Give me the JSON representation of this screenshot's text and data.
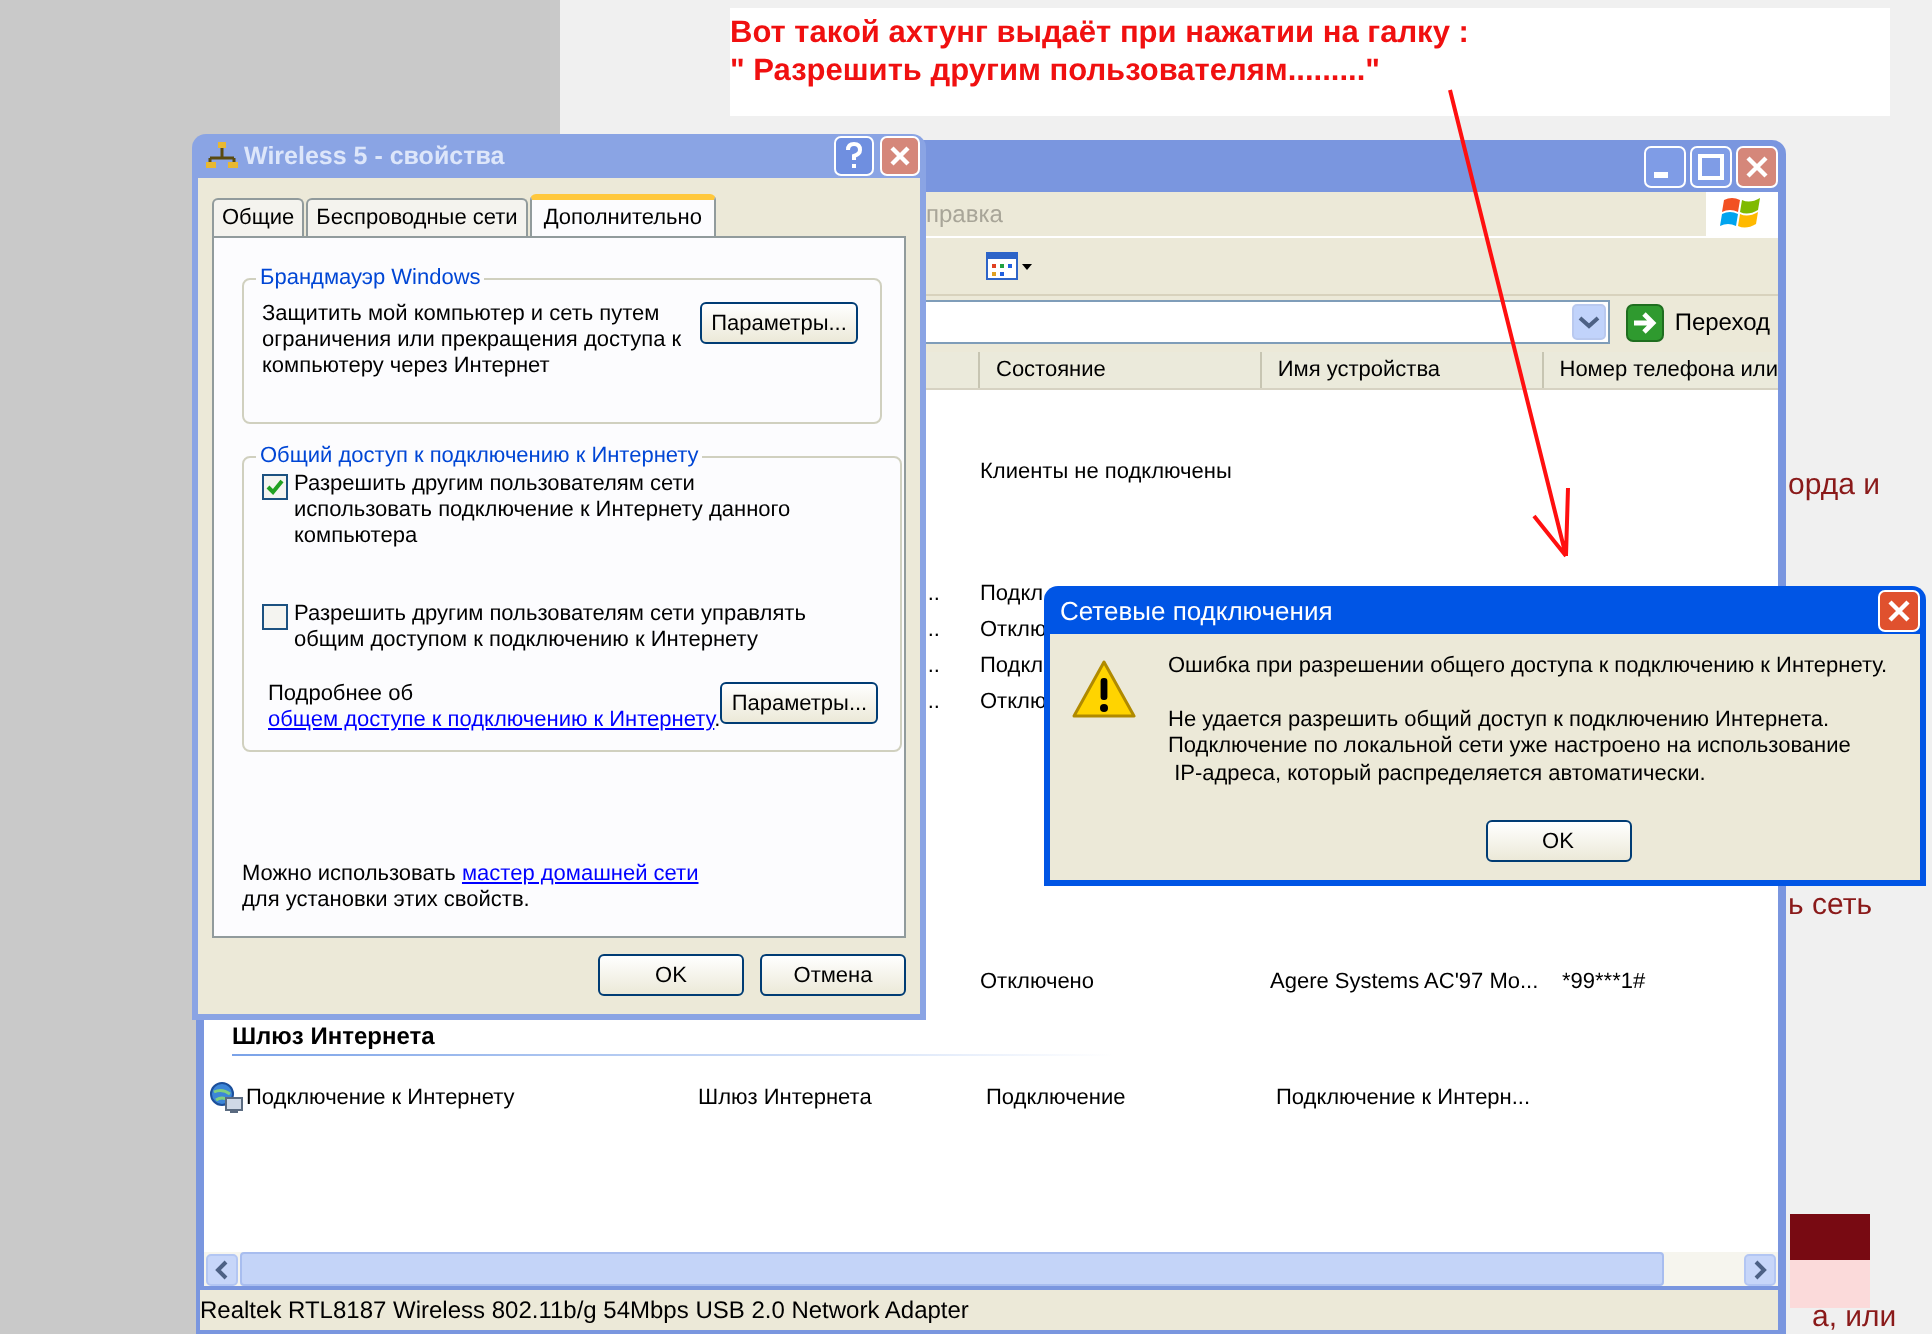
{
  "annotation": {
    "lines": [
      "Вот такой ахтунг выдаёт при нажатии на галку :",
      "\" Разрешить другим пользователям.........\""
    ]
  },
  "background_page": {
    "fragments": [
      "орда и",
      "ь сеть",
      "а, или"
    ]
  },
  "explorer": {
    "menu_fragment": "правка",
    "go_button": "Переход",
    "columns": [
      "Состояние",
      "Имя устройства",
      "Номер телефона или"
    ],
    "rows": [
      {
        "status": "Клиенты не подключены"
      },
      {
        "marker": "..",
        "status": "Подкл"
      },
      {
        "marker": "..",
        "status": "Отклю"
      },
      {
        "marker": "..",
        "status": "Подкл"
      },
      {
        "marker": "..",
        "status": "Отклю"
      },
      {
        "status": "Отключено",
        "device": "Agere Systems AC'97 Mo...",
        "phone": "*99***1#"
      }
    ],
    "group_title": "Шлюз Интернета",
    "gateway_row": {
      "name": "Подключение к Интернету",
      "type": "Шлюз Интернета",
      "status": "Подключение",
      "device": "Подключение к Интерн..."
    },
    "status_bar": "Realtek RTL8187 Wireless 802.11b/g 54Mbps USB 2.0 Network Adapter"
  },
  "properties": {
    "title": "Wireless 5 - свойства",
    "tabs": [
      {
        "label": "Общие",
        "selected": false
      },
      {
        "label": "Беспроводные сети",
        "selected": false
      },
      {
        "label": "Дополнительно",
        "selected": true
      }
    ],
    "firewall": {
      "title": "Брандмауэр Windows",
      "text": "Защитить мой компьютер и сеть путем\nограничения или прекращения доступа к\nкомпьютеру через Интернет",
      "button": "Параметры..."
    },
    "sharing": {
      "title": "Общий доступ к подключению к Интернету",
      "options": [
        {
          "label": "Разрешить другим пользователям сети\nиспользовать подключение к Интернету данного\nкомпьютера",
          "checked": true
        },
        {
          "label": "Разрешить другим пользователям сети управлять\nобщим доступом к подключению к Интернету",
          "checked": false
        }
      ],
      "more_prefix": "Подробнее об",
      "more_link": "общем доступе к подключению к Интернету",
      "more_suffix": ".",
      "button": "Параметры..."
    },
    "footer": {
      "prefix": "Можно использовать",
      "link": "мастер домашней сети",
      "suffix": "для установки этих свойств."
    },
    "buttons": [
      "OK",
      "Отмена"
    ]
  },
  "error": {
    "title": "Сетевые подключения",
    "heading": "Ошибка при разрешении общего доступа к подключению к Интернету.",
    "message": "Не удается разрешить общий доступ к подключению Интернета.\nПодключение по локальной сети уже настроено на использование\n IP-адреса, который распределяется автоматически.",
    "button": "OK"
  }
}
